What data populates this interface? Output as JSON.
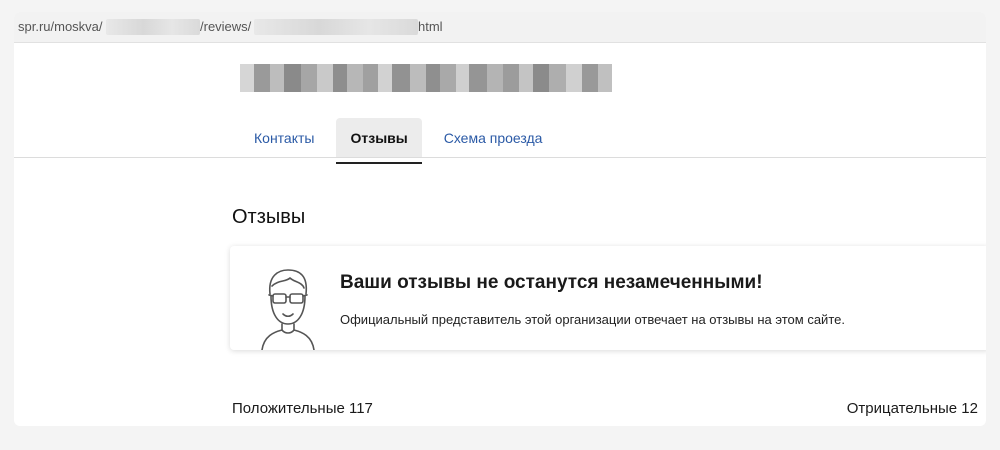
{
  "address_bar": {
    "url_part_1": "spr.ru/moskva/",
    "url_part_2": "/reviews/",
    "url_part_3": "html"
  },
  "tabs": [
    {
      "label": "Контакты",
      "active": false
    },
    {
      "label": "Отзывы",
      "active": true
    },
    {
      "label": "Схема проезда",
      "active": false
    }
  ],
  "section_title": "Отзывы",
  "notice": {
    "title": "Ваши отзывы не останутся незамеченными!",
    "text": "Официальный представитель этой организации отвечает на отзывы на этом сайте.",
    "icon": "person-with-glasses-icon"
  },
  "filters": {
    "positive": "Положительные 117",
    "negative": "Отрицательные 12"
  },
  "colors": {
    "link": "#2b5aa6",
    "active_tab_bg": "#ececec"
  }
}
